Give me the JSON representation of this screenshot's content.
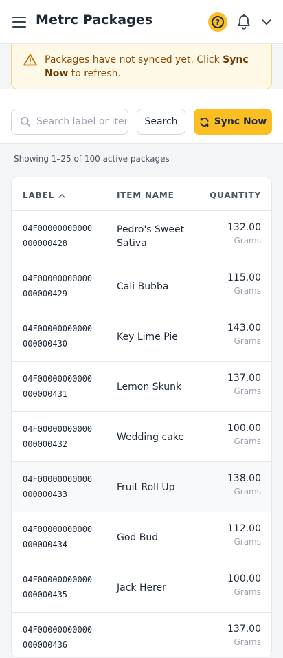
{
  "header": {
    "title": "Metrc Packages",
    "help_icon": "question-circle-icon",
    "help_glyph": "?",
    "bell_icon": "bell-icon",
    "account_icon": "chevron-down-icon",
    "accent_color": "#fbbf24"
  },
  "banner": {
    "icon": "warning-triangle-icon",
    "text_before": "Packages have not synced yet. Click ",
    "text_bold": "Sync Now",
    "text_after": " to refresh.",
    "bg_color": "#fef9e6",
    "text_color": "#8a4b08"
  },
  "toolbar": {
    "search_placeholder": "Search label or item",
    "search_value": "",
    "search_label": "Search",
    "sync_label": "Sync Now",
    "sync_icon": "refresh-icon"
  },
  "summary": {
    "showing_text": "Showing 1–25 of 100 active packages"
  },
  "table": {
    "columns": {
      "label": "LABEL",
      "item_name": "ITEM NAME",
      "quantity": "QUANTITY"
    },
    "sort": {
      "column": "label",
      "direction": "ascending",
      "icon": "chevron-up-icon"
    },
    "rows": [
      {
        "label_line1": "04F00000000000",
        "label_line2": "000000428",
        "item_name": "Pedro's Sweet Sativa",
        "quantity": "132.00",
        "unit": "Grams"
      },
      {
        "label_line1": "04F00000000000",
        "label_line2": "000000429",
        "item_name": "Cali Bubba",
        "quantity": "115.00",
        "unit": "Grams"
      },
      {
        "label_line1": "04F00000000000",
        "label_line2": "000000430",
        "item_name": "Key Lime Pie",
        "quantity": "143.00",
        "unit": "Grams"
      },
      {
        "label_line1": "04F00000000000",
        "label_line2": "000000431",
        "item_name": "Lemon Skunk",
        "quantity": "137.00",
        "unit": "Grams"
      },
      {
        "label_line1": "04F00000000000",
        "label_line2": "000000432",
        "item_name": "Wedding cake",
        "quantity": "100.00",
        "unit": "Grams"
      },
      {
        "label_line1": "04F00000000000",
        "label_line2": "000000433",
        "item_name": "Fruit Roll Up",
        "quantity": "138.00",
        "unit": "Grams"
      },
      {
        "label_line1": "04F00000000000",
        "label_line2": "000000434",
        "item_name": "God Bud",
        "quantity": "112.00",
        "unit": "Grams"
      },
      {
        "label_line1": "04F00000000000",
        "label_line2": "000000435",
        "item_name": "Jack Herer",
        "quantity": "100.00",
        "unit": "Grams"
      },
      {
        "label_line1": "04F00000000000",
        "label_line2": "000000436",
        "item_name": "",
        "quantity": "137.00",
        "unit": "Grams"
      }
    ]
  }
}
